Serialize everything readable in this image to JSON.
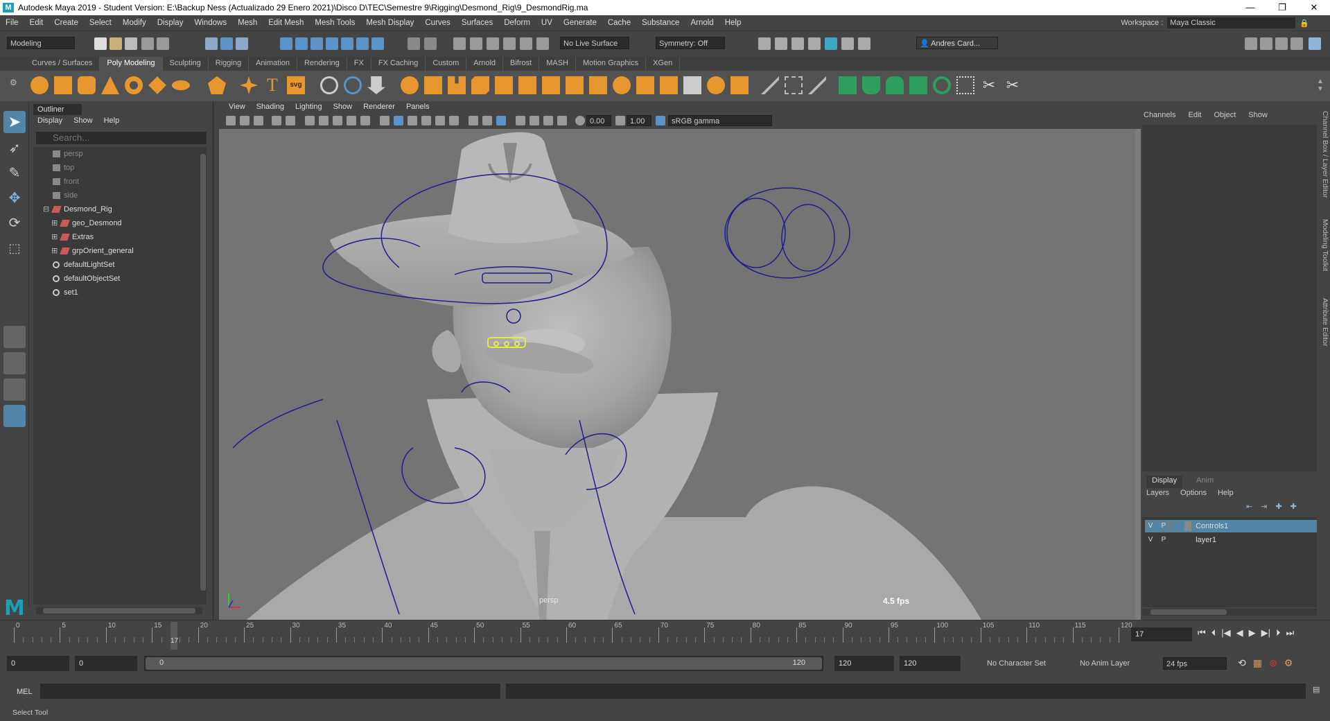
{
  "window": {
    "title": "Autodesk Maya 2019 - Student Version: E:\\Backup Ness (Actualizado 29 Enero 2021)\\Disco D\\TEC\\Semestre 9\\Rigging\\Desmond_Rig\\9_DesmondRig.ma",
    "buttons": [
      "—",
      "❐",
      "✕"
    ]
  },
  "menubar": {
    "items": [
      "File",
      "Edit",
      "Create",
      "Select",
      "Modify",
      "Display",
      "Windows",
      "Mesh",
      "Edit Mesh",
      "Mesh Tools",
      "Mesh Display",
      "Curves",
      "Surfaces",
      "Deform",
      "UV",
      "Generate",
      "Cache",
      "Substance",
      "Arnold",
      "Help"
    ],
    "workspace_label": "Workspace :",
    "workspace_value": "Maya Classic"
  },
  "statusline": {
    "mode": "Modeling",
    "live_surface": "No Live Surface",
    "symmetry": "Symmetry: Off",
    "user": "Andres Card..."
  },
  "shelf": {
    "tabs": [
      "Curves / Surfaces",
      "Poly Modeling",
      "Sculpting",
      "Rigging",
      "Animation",
      "Rendering",
      "FX",
      "FX Caching",
      "Custom",
      "Arnold",
      "Bifrost",
      "MASH",
      "Motion Graphics",
      "XGen"
    ],
    "active_tab": "Poly Modeling",
    "icons": [
      "sphere-icon",
      "cube-icon",
      "cylinder-icon",
      "cone-icon",
      "torus-icon",
      "plane-icon",
      "disc-icon",
      "platonic-icon",
      "super-shape-icon",
      "text-icon",
      "svg-icon",
      "combine-icon",
      "separate-icon",
      "smooth-icon",
      "booleans-icon",
      "extrude-icon",
      "bridge-icon",
      "bevel-icon",
      "merge-icon",
      "fill-hole-icon",
      "mirror-icon",
      "multi-cut-icon",
      "target-weld-icon",
      "connect-icon",
      "quad-draw-icon",
      "uv-editor-icon"
    ]
  },
  "outliner": {
    "tab": "Outliner",
    "menu": [
      "Display",
      "Show",
      "Help"
    ],
    "search_placeholder": "Search...",
    "items": [
      {
        "label": "persp",
        "indent": 0,
        "dim": true,
        "type": "camera"
      },
      {
        "label": "top",
        "indent": 0,
        "dim": true,
        "type": "camera"
      },
      {
        "label": "front",
        "indent": 0,
        "dim": true,
        "type": "camera"
      },
      {
        "label": "side",
        "indent": 0,
        "dim": true,
        "type": "camera"
      },
      {
        "label": "Desmond_Rig",
        "indent": 0,
        "dim": false,
        "type": "group",
        "expand": "⊟"
      },
      {
        "label": "geo_Desmond",
        "indent": 1,
        "dim": false,
        "type": "group",
        "expand": "⊞"
      },
      {
        "label": "Extras",
        "indent": 1,
        "dim": false,
        "type": "group",
        "expand": "⊞"
      },
      {
        "label": "grpOrient_general",
        "indent": 1,
        "dim": false,
        "type": "group",
        "expand": "⊞"
      },
      {
        "label": "defaultLightSet",
        "indent": 0,
        "dim": false,
        "type": "set"
      },
      {
        "label": "defaultObjectSet",
        "indent": 0,
        "dim": false,
        "type": "set"
      },
      {
        "label": "set1",
        "indent": 0,
        "dim": false,
        "type": "set"
      }
    ]
  },
  "viewport": {
    "menu": [
      "View",
      "Shading",
      "Lighting",
      "Show",
      "Renderer",
      "Panels"
    ],
    "exposure": "0.00",
    "gamma": "1.00",
    "color_space": "sRGB gamma",
    "camera_label": "persp",
    "fps": "4.5 fps"
  },
  "channelbox": {
    "menu": [
      "Channels",
      "Edit",
      "Object",
      "Show"
    ],
    "layer_tabs": [
      "Display",
      "Anim"
    ],
    "layer_menu": [
      "Layers",
      "Options",
      "Help"
    ],
    "layers": [
      {
        "v": "V",
        "p": "P",
        "name": "Controls1",
        "selected": true
      },
      {
        "v": "V",
        "p": "P",
        "name": "layer1",
        "selected": false
      }
    ],
    "side_tabs": [
      "Channel Box / Layer Editor",
      "Modeling Toolkit",
      "Attribute Editor"
    ]
  },
  "timeline": {
    "ticks": [
      "0",
      "5",
      "10",
      "15",
      "20",
      "25",
      "30",
      "35",
      "40",
      "45",
      "50",
      "55",
      "60",
      "65",
      "70",
      "75",
      "80",
      "85",
      "90",
      "95",
      "100",
      "105",
      "110",
      "115",
      "120"
    ],
    "current_frame": "17",
    "current_frame_field": "17"
  },
  "range": {
    "start": "0",
    "playback_start": "0",
    "slider_start": "0",
    "slider_end": "120",
    "playback_end": "120",
    "end": "120",
    "character_set": "No Character Set",
    "anim_layer": "No Anim Layer",
    "fps": "24 fps"
  },
  "cmdline": {
    "label": "MEL"
  },
  "helpline": {
    "text": "Select Tool"
  },
  "colors": {
    "accent_selected": "#5285a6",
    "shelf_orange": "#e8962e",
    "shelf_green": "#2e9e5e",
    "curve_blue": "#1e1e8a",
    "selected_curve": "#e8e84a"
  }
}
